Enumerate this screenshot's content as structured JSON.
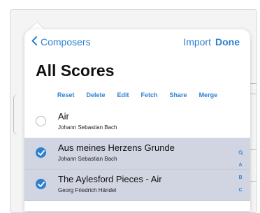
{
  "nav": {
    "back_label": "Composers",
    "import_label": "Import",
    "done_label": "Done"
  },
  "page_title": "All Scores",
  "actions": [
    "Reset",
    "Delete",
    "Edit",
    "Fetch",
    "Share",
    "Merge"
  ],
  "scores": [
    {
      "title": "Air",
      "composer": "Johann Sebastian Bach",
      "selected": false
    },
    {
      "title": "Aus meines Herzens Grunde",
      "composer": "Johann Sebastian Bach",
      "selected": true
    },
    {
      "title": "The Aylesford Pieces - Air",
      "composer": "Georg Friedrich Händel",
      "selected": true
    }
  ],
  "section_index": [
    "A",
    "B",
    "C"
  ],
  "colors": {
    "accent": "#2f80d1",
    "selected_row": "#d1d5e2"
  },
  "icons": {
    "back": "chevron-left-icon",
    "check": "checkmark-icon",
    "index_search": "search-icon"
  }
}
